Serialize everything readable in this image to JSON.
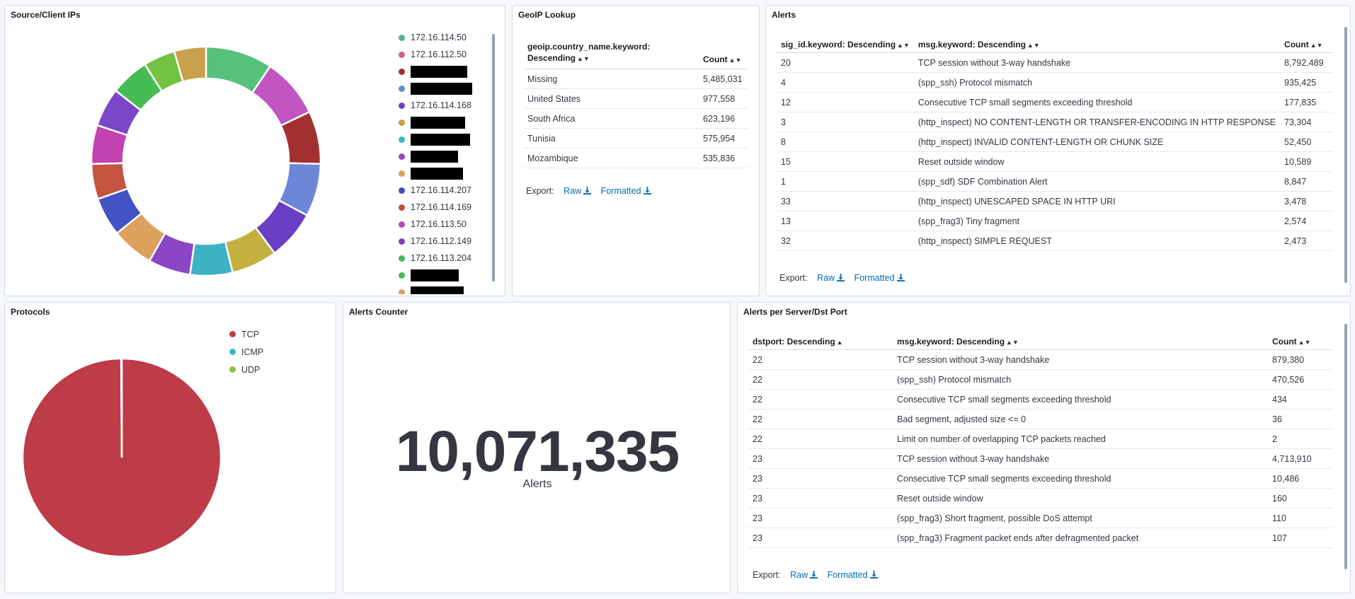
{
  "source_ips": {
    "title": "Source/Client IPs",
    "legend": [
      {
        "label": "172.16.114.50",
        "color": "#54b399"
      },
      {
        "label": "172.16.112.50",
        "color": "#d36086"
      },
      {
        "label": "",
        "color": "#a4312f"
      },
      {
        "label": "",
        "color": "#6092c0"
      },
      {
        "label": "172.16.114.168",
        "color": "#6f3fc5"
      },
      {
        "label": "",
        "color": "#c4a03b"
      },
      {
        "label": "",
        "color": "#38b8bf"
      },
      {
        "label": "",
        "color": "#9448c4"
      },
      {
        "label": "",
        "color": "#d99f5c"
      },
      {
        "label": "172.16.114.207",
        "color": "#3e4bc1"
      },
      {
        "label": "172.16.114.169",
        "color": "#c1503f"
      },
      {
        "label": "172.16.113.50",
        "color": "#c242b6"
      },
      {
        "label": "172.16.112.149",
        "color": "#7b41c5"
      },
      {
        "label": "172.16.113.204",
        "color": "#3fbb5a"
      },
      {
        "label": "",
        "color": "#3fbb5a"
      },
      {
        "label": "",
        "color": "#d99f5c"
      }
    ]
  },
  "chart_data": [
    {
      "type": "pie",
      "title": "Source/Client IPs",
      "donut": true,
      "categories": [
        "172.16.114.50",
        "172.16.112.50",
        "[redacted]",
        "[redacted]",
        "172.16.114.168",
        "[redacted]",
        "[redacted]",
        "[redacted]",
        "[redacted]",
        "172.16.114.207",
        "172.16.114.169",
        "172.16.113.50",
        "172.16.112.149",
        "172.16.113.204",
        "[redacted]",
        "[redacted]"
      ],
      "values": [
        9.5,
        8.5,
        7.5,
        7.5,
        7,
        6.5,
        6,
        6,
        6,
        5.5,
        5,
        5.5,
        5.5,
        5.5,
        4.5,
        4.5
      ],
      "colors": [
        "#57c17b",
        "#c155c1",
        "#a33030",
        "#6e86d8",
        "#6a3ec5",
        "#c4b03f",
        "#3cb3c2",
        "#8a46c4",
        "#dca15d",
        "#4352c5",
        "#c35440",
        "#c341b1",
        "#7c47c6",
        "#46bd54",
        "#74c241",
        "#c9a14a"
      ]
    },
    {
      "type": "pie",
      "title": "Protocols",
      "categories": [
        "TCP",
        "ICMP",
        "UDP"
      ],
      "values": [
        99.9,
        0.05,
        0.05
      ],
      "colors": [
        "#bd3c47",
        "#38b8bf",
        "#8ac43f"
      ]
    }
  ],
  "geoip": {
    "title": "GeoIP Lookup",
    "col1": "geoip.country_name.keyword: Descending",
    "col2": "Count",
    "rows": [
      {
        "k": "Missing",
        "v": "5,485,031"
      },
      {
        "k": "United States",
        "v": "977,558"
      },
      {
        "k": "South Africa",
        "v": "623,196"
      },
      {
        "k": "Tunisia",
        "v": "575,954"
      },
      {
        "k": "Mozambique",
        "v": "535,836"
      }
    ],
    "export_label": "Export:",
    "raw": "Raw",
    "formatted": "Formatted"
  },
  "alerts": {
    "title": "Alerts",
    "col1": "sig_id.keyword: Descending",
    "col2": "msg.keyword: Descending",
    "col3": "Count",
    "rows": [
      {
        "a": "20",
        "b": "TCP session without 3-way handshake",
        "c": "8,792,489"
      },
      {
        "a": "4",
        "b": "(spp_ssh) Protocol mismatch",
        "c": "935,425"
      },
      {
        "a": "12",
        "b": "Consecutive TCP small segments exceeding threshold",
        "c": "177,835"
      },
      {
        "a": "3",
        "b": "(http_inspect) NO CONTENT-LENGTH OR TRANSFER-ENCODING IN HTTP RESPONSE",
        "c": "73,304"
      },
      {
        "a": "8",
        "b": "(http_inspect) INVALID CONTENT-LENGTH OR CHUNK SIZE",
        "c": "52,450"
      },
      {
        "a": "15",
        "b": "Reset outside window",
        "c": "10,589"
      },
      {
        "a": "1",
        "b": "(spp_sdf) SDF Combination Alert",
        "c": "8,847"
      },
      {
        "a": "33",
        "b": "(http_inspect) UNESCAPED SPACE IN HTTP URI",
        "c": "3,478"
      },
      {
        "a": "13",
        "b": "(spp_frag3) Tiny fragment",
        "c": "2,574"
      },
      {
        "a": "32",
        "b": "(http_inspect) SIMPLE REQUEST",
        "c": "2,473"
      }
    ],
    "export_label": "Export:",
    "raw": "Raw",
    "formatted": "Formatted"
  },
  "protocols": {
    "title": "Protocols",
    "legend": [
      {
        "label": "TCP",
        "color": "#bd3c47"
      },
      {
        "label": "ICMP",
        "color": "#38b8bf"
      },
      {
        "label": "UDP",
        "color": "#8ac43f"
      }
    ]
  },
  "counter": {
    "title": "Alerts Counter",
    "value": "10,071,335",
    "label": "Alerts"
  },
  "alerts_port": {
    "title": "Alerts per Server/Dst Port",
    "col1": "dstport: Descending",
    "col2": "msg.keyword: Descending",
    "col3": "Count",
    "rows": [
      {
        "a": "22",
        "b": "TCP session without 3-way handshake",
        "c": "879,380"
      },
      {
        "a": "22",
        "b": "(spp_ssh) Protocol mismatch",
        "c": "470,526"
      },
      {
        "a": "22",
        "b": "Consecutive TCP small segments exceeding threshold",
        "c": "434"
      },
      {
        "a": "22",
        "b": "Bad segment, adjusted size <= 0",
        "c": "36"
      },
      {
        "a": "22",
        "b": "Limit on number of overlapping TCP packets reached",
        "c": "2"
      },
      {
        "a": "23",
        "b": "TCP session without 3-way handshake",
        "c": "4,713,910"
      },
      {
        "a": "23",
        "b": "Consecutive TCP small segments exceeding threshold",
        "c": "10,486"
      },
      {
        "a": "23",
        "b": "Reset outside window",
        "c": "160"
      },
      {
        "a": "23",
        "b": "(spp_frag3) Short fragment, possible DoS attempt",
        "c": "110"
      },
      {
        "a": "23",
        "b": "(spp_frag3) Fragment packet ends after defragmented packet",
        "c": "107"
      }
    ],
    "export_label": "Export:",
    "raw": "Raw",
    "formatted": "Formatted"
  }
}
